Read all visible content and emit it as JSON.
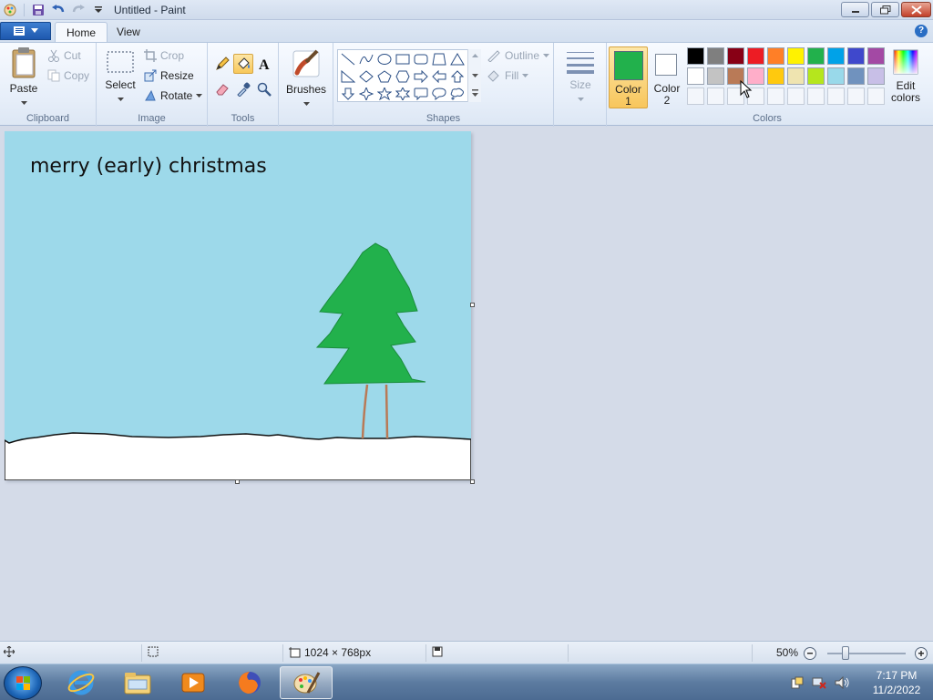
{
  "window": {
    "title": "Untitled - Paint"
  },
  "ribbon": {
    "tabs": [
      {
        "label": "Home",
        "active": true
      },
      {
        "label": "View",
        "active": false
      }
    ],
    "clipboard": {
      "paste": "Paste",
      "cut": "Cut",
      "copy": "Copy",
      "group": "Clipboard"
    },
    "image": {
      "select": "Select",
      "crop": "Crop",
      "resize": "Resize",
      "rotate": "Rotate",
      "group": "Image"
    },
    "tools": {
      "group": "Tools",
      "items": [
        "pencil-icon",
        "fill-icon",
        "text-icon",
        "eraser-icon",
        "color-picker-icon",
        "magnifier-icon"
      ],
      "selected": "fill-icon"
    },
    "brushes": {
      "label": "Brushes"
    },
    "shapes": {
      "group": "Shapes",
      "outline": "Outline",
      "fill": "Fill"
    },
    "size": {
      "label": "Size"
    },
    "colors": {
      "group": "Colors",
      "color1_line1": "Color",
      "color1_line2": "1",
      "color2_line1": "Color",
      "color2_line2": "2",
      "edit_line1": "Edit",
      "edit_line2": "colors",
      "color1": "#22b14c",
      "color2": "#ffffff",
      "palette_row1": [
        "#000000",
        "#7f7f7f",
        "#880015",
        "#ed1c24",
        "#ff7f27",
        "#fff200",
        "#22b14c",
        "#00a2e8",
        "#3f48cc",
        "#a349a4"
      ],
      "palette_row2": [
        "#ffffff",
        "#c3c3c3",
        "#b97a57",
        "#ffaec9",
        "#ffc90e",
        "#efe4b0",
        "#b5e61d",
        "#99d9ea",
        "#7092be",
        "#c8bfe7"
      ]
    }
  },
  "canvas": {
    "text": "merry (early) christmas",
    "sky_color": "#9dd9ea",
    "tree_color": "#22b14c",
    "trunk_color": "#b97a57",
    "snow_color": "#ffffff"
  },
  "status": {
    "dimensions": "1024 × 768px",
    "zoom": "50%"
  },
  "taskbar": {
    "items": [
      "internet-explorer-icon",
      "file-explorer-icon",
      "media-player-icon",
      "firefox-icon",
      "paint-icon"
    ],
    "active": "paint-icon",
    "time": "7:17 PM",
    "date": "11/2/2022"
  }
}
